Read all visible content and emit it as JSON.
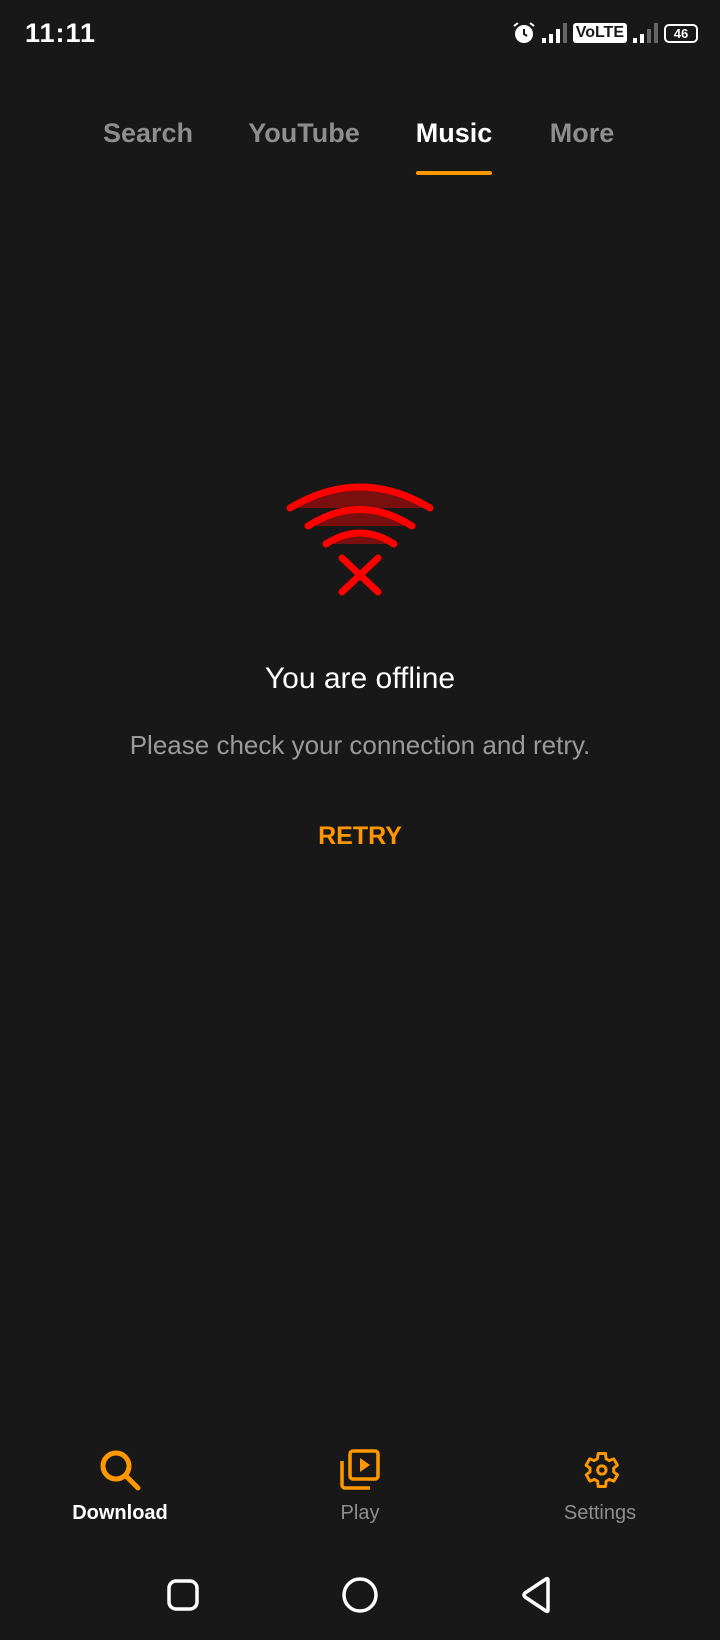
{
  "status_bar": {
    "time": "11:11",
    "network": "VoLTE",
    "battery": "46",
    "icons": [
      "alarm-icon",
      "signal-icon",
      "volte-badge",
      "signal-icon",
      "battery-icon"
    ]
  },
  "tabs": [
    {
      "label": "Search",
      "active": false
    },
    {
      "label": "YouTube",
      "active": false
    },
    {
      "label": "Music",
      "active": true
    },
    {
      "label": "More",
      "active": false
    }
  ],
  "offline": {
    "icon": "wifi-off-icon",
    "title": "You are offline",
    "message": "Please check your connection and retry.",
    "retry_label": "RETRY"
  },
  "bottom_nav": [
    {
      "label": "Download",
      "icon": "search-icon",
      "active": true
    },
    {
      "label": "Play",
      "icon": "play-library-icon",
      "active": false
    },
    {
      "label": "Settings",
      "icon": "gear-icon",
      "active": false
    }
  ],
  "colors": {
    "accent": "#FF9800",
    "background": "#181818",
    "error": "#FF0000"
  }
}
